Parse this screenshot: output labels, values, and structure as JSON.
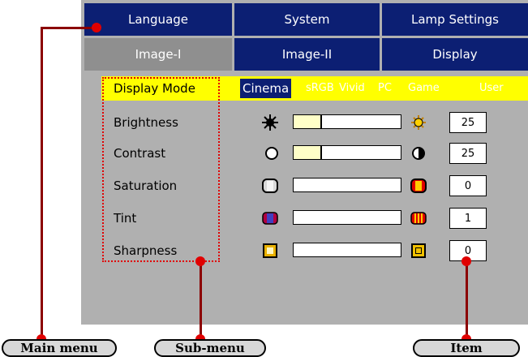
{
  "menu": {
    "tabs_row1": [
      "Language",
      "System",
      "Lamp Settings"
    ],
    "tabs_row2": [
      "Image-I",
      "Image-II",
      "Display"
    ],
    "active_tab": "Image-I"
  },
  "display_mode": {
    "label": "Display Mode",
    "options": [
      "Cinema",
      "sRGB",
      "Vivid",
      "PC",
      "Game",
      "User"
    ],
    "selected": "Cinema"
  },
  "settings": [
    {
      "label": "Brightness",
      "value": "25",
      "level": 0.25,
      "left_icon": "sun-small-icon",
      "right_icon": "sun-large-icon"
    },
    {
      "label": "Contrast",
      "value": "25",
      "level": 0.25,
      "left_icon": "circle-outline-icon",
      "right_icon": "half-circle-icon"
    },
    {
      "label": "Saturation",
      "value": "0",
      "level": 0.0,
      "left_icon": "gray-cylinder-icon",
      "right_icon": "color-cylinder-icon"
    },
    {
      "label": "Tint",
      "value": "1",
      "level": 0.0,
      "left_icon": "magenta-tint-icon",
      "right_icon": "striped-tint-icon"
    },
    {
      "label": "Sharpness",
      "value": "0",
      "level": 0.0,
      "left_icon": "soft-square-icon",
      "right_icon": "sharp-square-icon"
    }
  ],
  "callouts": {
    "main_menu": "Main menu",
    "sub_menu": "Sub-menu",
    "item": "Item"
  },
  "colors": {
    "panel": "#b0b0b0",
    "tab_inactive": "#0c1f73",
    "tab_active": "#8f8f8f",
    "highlight_bar": "#ffff00",
    "callout_line": "#8b0000",
    "callout_dot": "#e00000"
  }
}
